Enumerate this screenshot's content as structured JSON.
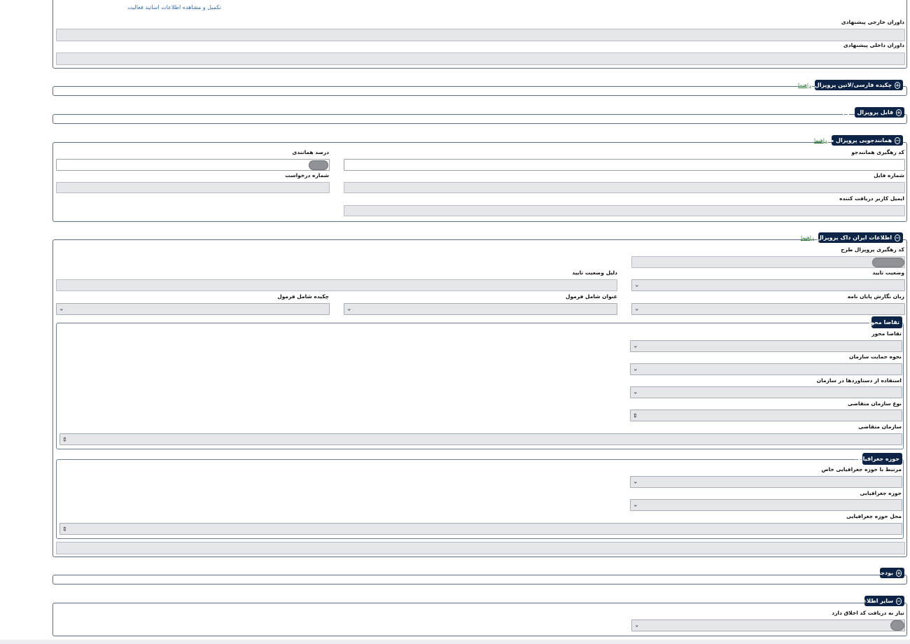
{
  "top_link": "تکمیل و مشاهده اطلاعات اساتید فعالیت",
  "top": {
    "external_referees_label": "داوران خارجی پیشنهادی",
    "internal_referees_label": "داوران داخلی پیشنهادی"
  },
  "abstract_section": {
    "title": "چکیده فارسی/لاتین پروپزال طرح",
    "help": "راهنما",
    "icon": "plus-circle-icon"
  },
  "file_section": {
    "title": "فایل پروپزال طرح",
    "icon": "plus-circle-icon"
  },
  "similarity_section": {
    "title": "همانندجویی پروپزال طرح",
    "help": "راهنما",
    "icon": "minus-circle-icon",
    "tracking_code_label": "کد رهگیری همانندجو",
    "similarity_percent_label": "درصد همانندی",
    "file_number_label": "شماره فایل",
    "request_number_label": "شماره درخواست",
    "recipient_email_label": "ایمیل کاربر دریافت کننده"
  },
  "irandoc_section": {
    "title": "اطلاعات ایران داک پروپزال طرح",
    "help": "راهنما",
    "icon": "minus-circle-icon",
    "tracking_code_label": "کد رهگیری پروپزال طرح",
    "approval_status_label": "وضعیت تایید",
    "approval_reason_label": "دلیل وضعیت تایید",
    "thesis_language_label": "زبان نگارش پایان نامه",
    "title_has_formula_label": "عنوان شامل فرمول",
    "abstract_has_formula_label": "چکیده شامل فرمول"
  },
  "demand_subsection": {
    "title": "تقاضا محور",
    "demand_based_label": "تقاضا محور",
    "support_type_label": "نحوه حمایت سازمان",
    "achievements_use_label": "استفاده از دستاوردها در سازمان",
    "applicant_org_type_label": "نوع سازمان متقاضی",
    "applicant_org_label": "سازمان متقاضی"
  },
  "geo_subsection": {
    "title": "حوزه جغرافیایی",
    "related_geo_label": "مرتبط با حوزه جغرافیایی خاص",
    "geo_area_label": "حوزه جغرافیایی",
    "geo_location_label": "محل حوزه جغرافیایی"
  },
  "budget_section": {
    "title": "بودجه",
    "icon": "plus-circle-icon"
  },
  "other_section": {
    "title": "سایر اطلاعات",
    "icon": "minus-circle-icon",
    "ethics_code_label": "نیاز به دریافت کد اخلاق دارد"
  }
}
